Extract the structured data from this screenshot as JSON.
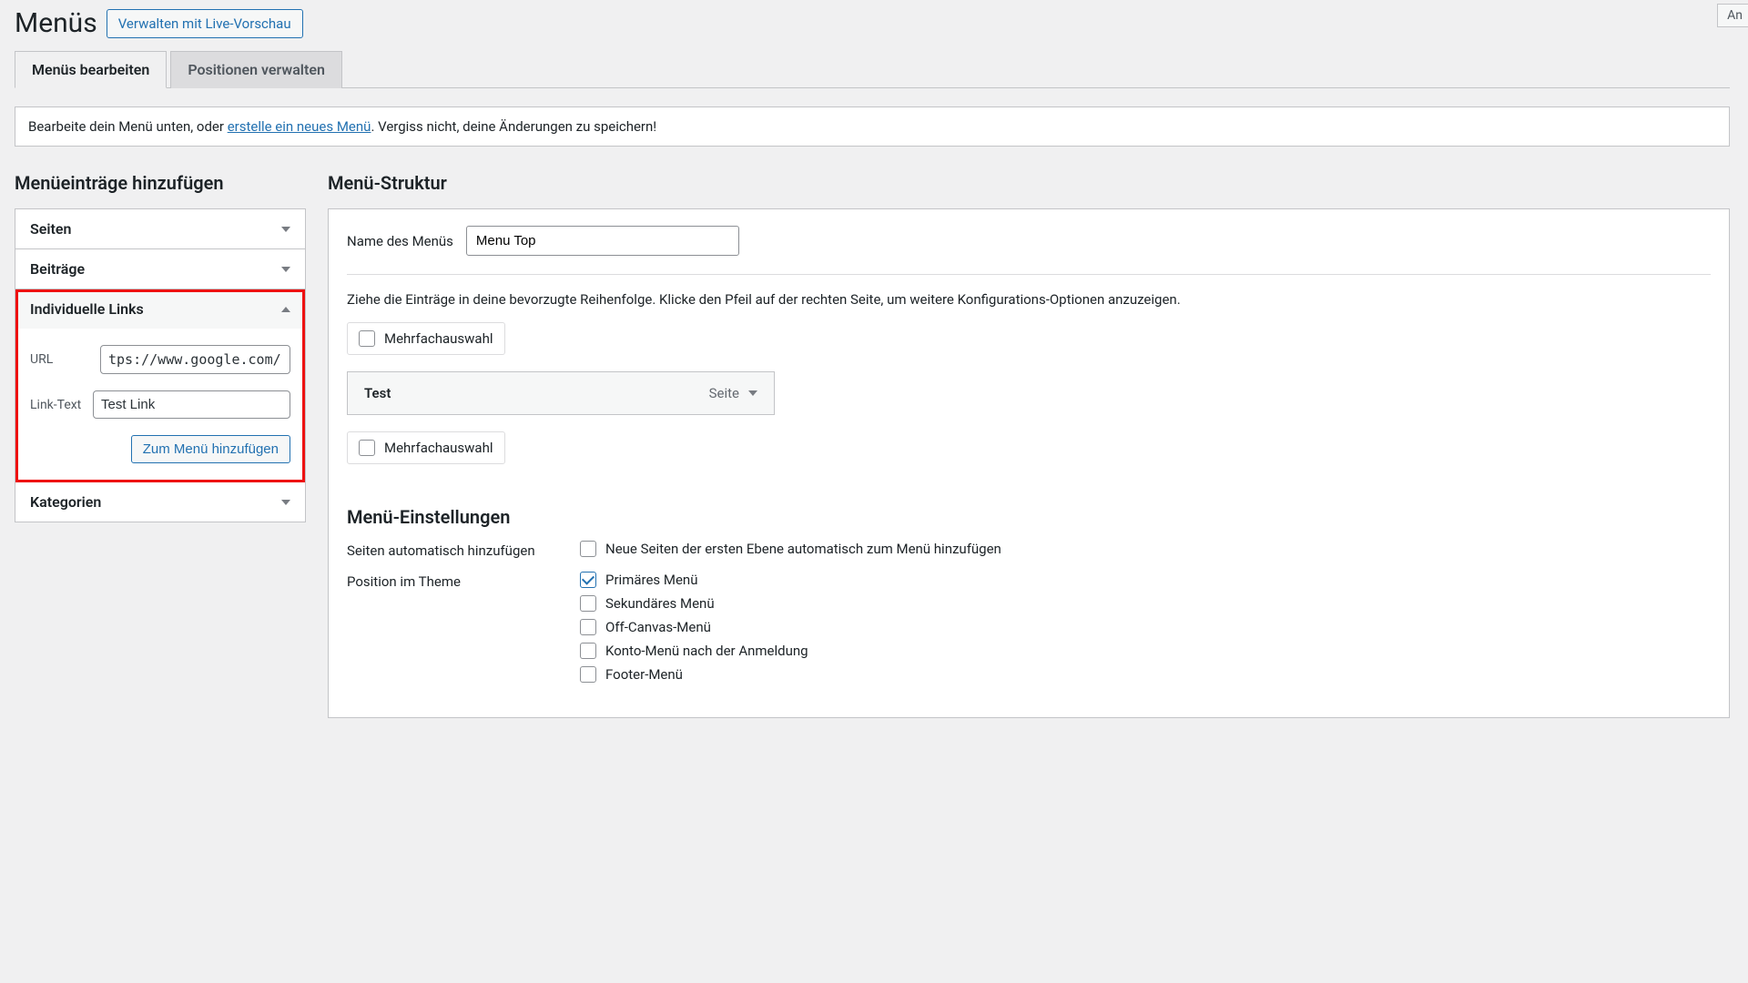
{
  "header": {
    "title": "Menüs",
    "live_preview_btn": "Verwalten mit Live-Vorschau",
    "top_right_fragment": "An"
  },
  "tabs": [
    {
      "label": "Menüs bearbeiten",
      "active": true
    },
    {
      "label": "Positionen verwalten",
      "active": false
    }
  ],
  "info": {
    "before": "Bearbeite dein Menü unten, oder ",
    "link": "erstelle ein neues Menü",
    "after": ". Vergiss nicht, deine Änderungen zu speichern!"
  },
  "left": {
    "heading": "Menüeinträge hinzufügen",
    "panels": {
      "seiten": "Seiten",
      "beitraege": "Beiträge",
      "links": "Individuelle Links",
      "kategorien": "Kategorien"
    },
    "link_form": {
      "url_label": "URL",
      "url_value": "tps://www.google.com/",
      "text_label": "Link-Text",
      "text_value": "Test Link",
      "add_btn": "Zum Menü hinzufügen"
    }
  },
  "right": {
    "heading": "Menü-Struktur",
    "name_label": "Name des Menüs",
    "name_value": "Menu Top",
    "drag_hint": "Ziehe die Einträge in deine bevorzugte Reihenfolge. Klicke den Pfeil auf der rechten Seite, um weitere Konfigurations-Optionen anzuzeigen.",
    "multi_select": "Mehrfachauswahl",
    "menu_item": {
      "name": "Test",
      "type": "Seite"
    },
    "settings": {
      "heading": "Menü-Einstellungen",
      "auto_add_label": "Seiten automatisch hinzufügen",
      "auto_add_opt": "Neue Seiten der ersten Ebene automatisch zum Menü hinzufügen",
      "position_label": "Position im Theme",
      "positions": [
        {
          "label": "Primäres Menü",
          "checked": true
        },
        {
          "label": "Sekundäres Menü",
          "checked": false
        },
        {
          "label": "Off-Canvas-Menü",
          "checked": false
        },
        {
          "label": "Konto-Menü nach der Anmeldung",
          "checked": false
        },
        {
          "label": "Footer-Menü",
          "checked": false
        }
      ]
    }
  }
}
